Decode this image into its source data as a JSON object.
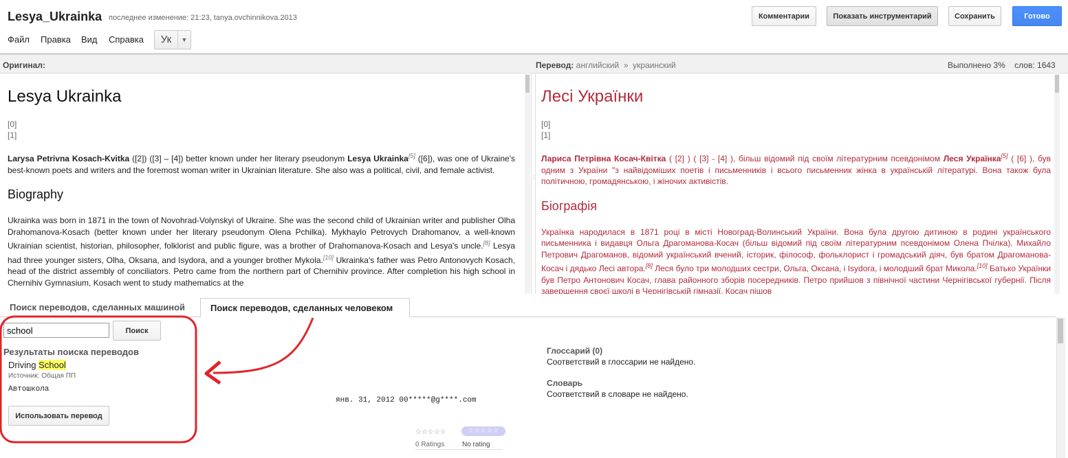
{
  "header": {
    "doc_title": "Lesya_Ukrainka",
    "last_modified": "последнее изменение: 21:23, tanya.ovchinnikova.2013",
    "menu": [
      "Файл",
      "Правка",
      "Вид",
      "Справка"
    ],
    "lang_select": "Ук",
    "buttons": {
      "comments": "Комментарии",
      "toolkit": "Показать инструментарий",
      "save": "Сохранить",
      "done": "Готово"
    }
  },
  "bar": {
    "original_label": "Оригинал:",
    "translation_label": "Перевод:",
    "source_lang": "английский",
    "arrow": "»",
    "target_lang": "украинский",
    "progress": "Выполнено 3%",
    "words": "слов: 1643"
  },
  "original": {
    "title": "Lesya Ukrainka",
    "refs": [
      "[0]",
      "[1]"
    ],
    "para1": {
      "name_bold": "Larysa Petrivna Kosach-Kvitka",
      "text_a": " ([2]) ([3] – [4]) better known under her literary pseudonym ",
      "pseudonym_bold": "Lesya Ukrainka",
      "sup": "[5]",
      "text_b": " ([6]), was one of Ukraine's best-known poets and writers and the foremost woman writer in Ukrainian literature. She also was a political, civil, and female activist."
    },
    "heading": "Biography",
    "para2": {
      "text_a": "Ukrainka was born in 1871 in the town of Novohrad-Volynskyi of Ukraine. She was the second child of Ukrainian writer and publisher Olha Drahomanova-Kosach (better known under her literary pseudonym Olena Pchilka). Mykhaylo Petrovych Drahomanov, a well-known Ukrainian scientist, historian, philosopher, folklorist and public figure, was a brother of Drahomanova-Kosach and Lesya's uncle.",
      "sup1": "[8]",
      "text_b": " Lesya had three younger sisters, Olha, Oksana, and Isydora, and a younger brother Mykola.",
      "sup2": "[10]",
      "text_c": " Ukrainka's father was Petro Antonovych Kosach, head of the district assembly of conciliators. Petro came from the northern part of Chernihiv province. After completion his high school in Chernihiv Gymnasium, Kosach went to study mathematics at the"
    }
  },
  "translation": {
    "title": "Лесі Українки",
    "refs": [
      "[0]",
      "[1]"
    ],
    "para1": {
      "name_bold": "Лариса Петрівна Косач-Квітка",
      "text_a": " ( [2] ) ( [3] - [4] ), більш відомий під своїм літературним псевдонімом ",
      "pseudonym_bold": "Леся Українка",
      "sup": "[5]",
      "text_b": " ( [6] ), був одним з України \"з найвідоміших поетів і письменників і всього письменник жінка в українській літературі. Вона також була політичною, громадянською, і жіночих активістів."
    },
    "heading": "Біографія",
    "para2": {
      "text_a": "Українка народилася в 1871 році в місті Новоград-Волинський України. Вона була другою дитиною в родині українського письменника і видавця Ольга Драгоманова-Косач (більш відомий під своїм літературним псевдонімом Олена Пчілка). Михайло Петрович Драгоманов, відомий український вчений, історик, філософ, фольклорист і громадський діяч, був братом Драгоманова-Косач і дядько Лесі автора.",
      "sup1": "[8]",
      "text_b": " Леся було три молодших сестри, Ольга, Оксана, і Isydora, і молодший брат Микола.",
      "sup2": "[10]",
      "text_c": " Батько Українки був Петро Антонович Косач, глава районного зборів посередників. Петро прийшов з північної частини Чернігівської губернії. Після завершення своєї школі в Чернігівській гімназії, Косач пішов"
    }
  },
  "tabs": {
    "machine": "Поиск переводов, сделанных машиной",
    "human": "Поиск переводов, сделанных человеком"
  },
  "search": {
    "value": "school",
    "button": "Поиск",
    "results_title": "Результаты поиска переводов"
  },
  "result": {
    "source_prefix": "Driving ",
    "source_highlight": "School",
    "origin": "Источник: Общая ПП",
    "target": "Автошкола",
    "meta": "янв. 31, 2012 00*****@g****.com",
    "use_button": "Использовать перевод",
    "stars": "☆☆☆☆☆",
    "ratings_count": "0 Ratings",
    "no_rating": "No rating"
  },
  "glossary": {
    "title": "Глоссарий (0)",
    "empty": "Соответствий в глоссарии не найдено."
  },
  "dictionary": {
    "title": "Словарь",
    "empty": "Соответствий в словаре не найдено."
  },
  "colors": {
    "translated_text": "#b22b3a",
    "done_button": "#4d90fe",
    "highlight": "#ffff66",
    "annotation": "#e0242b"
  }
}
